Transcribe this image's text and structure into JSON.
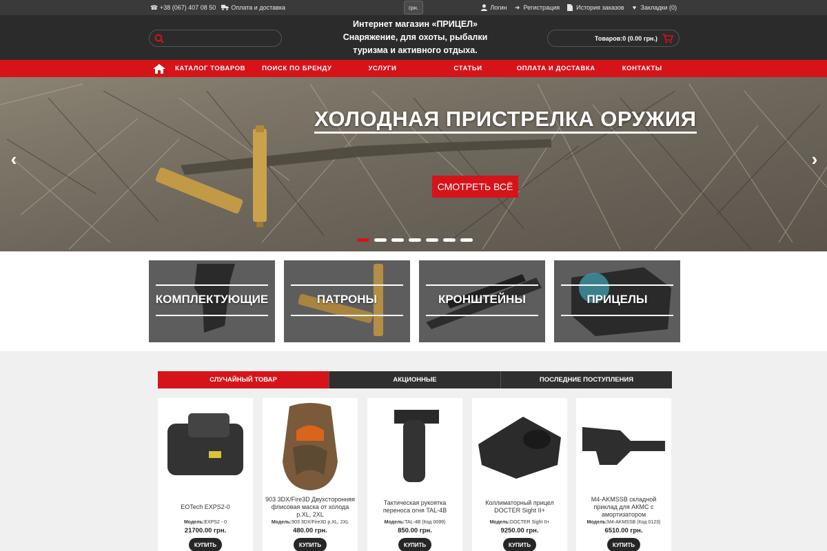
{
  "topbar": {
    "phone": "+38 (067) 407 08 50",
    "delivery_link": "Оплата и доставка",
    "currency": "грн.",
    "login": "Логин",
    "register": "Регистрация",
    "order_history": "История заказов",
    "bookmarks": "Закладки (0)"
  },
  "header": {
    "tagline_line1": "Интернет магазин «ПРИЦЕЛ»",
    "tagline_line2": "Снаряжение, для охоты, рыбалки",
    "tagline_line3": "туризма и активного отдыха.",
    "search_placeholder": "",
    "cart_label": "Товаров:0 (0.00 грн.)"
  },
  "nav": {
    "items": [
      "КАТАЛОГ ТОВАРОВ",
      "ПОИСК ПО БРЕНДУ",
      "УСЛУГИ",
      "СТАТЬИ",
      "ОПЛАТА И ДОСТАВКА",
      "КОНТАКТЫ"
    ]
  },
  "hero": {
    "title": "ХОЛОДНАЯ ПРИСТРЕЛКА ОРУЖИЯ",
    "button": "СМОТРЕТЬ ВСЁ",
    "prev": "‹",
    "next": "›",
    "slide_count": 7,
    "active_slide": 1
  },
  "categories": [
    {
      "label": "КОМПЛЕКТУЮЩИЕ"
    },
    {
      "label": "ПАТРОНЫ"
    },
    {
      "label": "КРОНШТЕЙНЫ"
    },
    {
      "label": "ПРИЦЕЛЫ"
    }
  ],
  "tabs": [
    {
      "label": "СЛУЧАЙНЫЙ ТОВАР",
      "active": true
    },
    {
      "label": "АКЦИОННЫЕ",
      "active": false
    },
    {
      "label": "ПОСЛЕДНИЕ ПОСТУПЛЕНИЯ",
      "active": false
    }
  ],
  "products": [
    {
      "name": "EOTech EXPS2-0",
      "model_label": "Модель:",
      "model": "EXPS2 - 0",
      "price": "21700.00 грн.",
      "buy": "КУПИТЬ"
    },
    {
      "name": "903 3DX/Fire3D Двухсторонняя флисовая маска от холода р.XL, 2XL",
      "model_label": "Модель:",
      "model": "903 3DX/Fire3D р.XL, 2XL",
      "price": "480.00 грн.",
      "buy": "КУПИТЬ"
    },
    {
      "name": "Тактическая рукоятка переноса огня TAL-4B",
      "model_label": "Модель:",
      "model": "TAL-4B (Код 0099)",
      "price": "850.00 грн.",
      "buy": "КУПИТЬ"
    },
    {
      "name": "Коллиматорный прицел DOCTER Sight II+",
      "model_label": "Модель:",
      "model": "DOCTER Sight II+",
      "price": "9250.00 грн.",
      "buy": "КУПИТЬ"
    },
    {
      "name": "M4-AKMSSB складной приклад для АКМС с амортизатором",
      "model_label": "Модель:",
      "model": "M4-AKMSSB (Код 0123)",
      "price": "6510.00 грн.",
      "buy": "КУПИТЬ"
    }
  ],
  "colors": {
    "accent_red": "#d7131a",
    "dark_header": "#2b2b2b",
    "topbar": "#3a3a3a"
  }
}
